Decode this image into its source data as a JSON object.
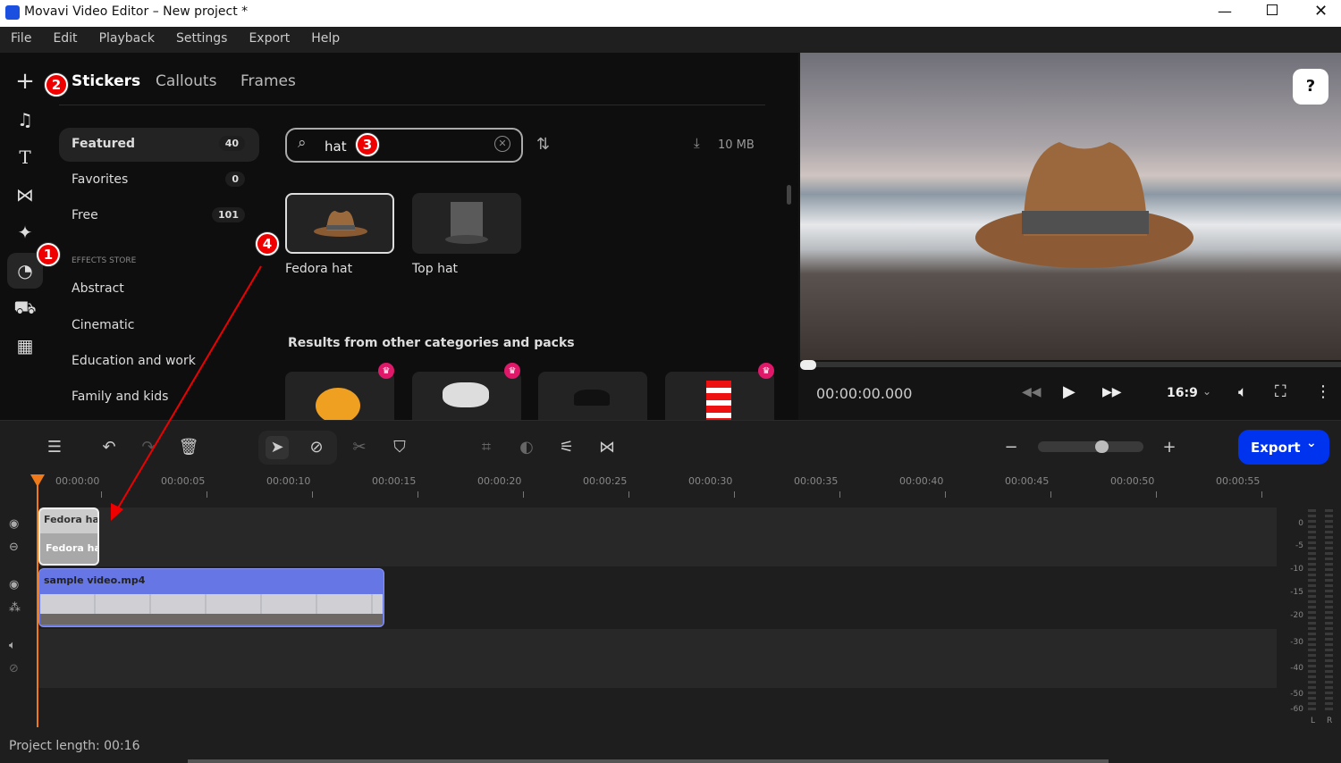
{
  "window": {
    "title": "Movavi Video Editor – New project *",
    "controls": [
      "minimize",
      "maximize",
      "close"
    ]
  },
  "menu": [
    "File",
    "Edit",
    "Playback",
    "Settings",
    "Export",
    "Help"
  ],
  "tabs": [
    {
      "label": "Stickers",
      "active": true
    },
    {
      "label": "Callouts"
    },
    {
      "label": "Frames"
    }
  ],
  "categories": [
    {
      "label": "Featured",
      "count": "40",
      "active": true
    },
    {
      "label": "Favorites",
      "count": "0"
    },
    {
      "label": "Free",
      "count": "101"
    }
  ],
  "effects_store": {
    "heading": "EFFECTS STORE",
    "items": [
      "Abstract",
      "Cinematic",
      "Education and work",
      "Family and kids"
    ]
  },
  "search": {
    "value": "hat",
    "download_size": "10 MB"
  },
  "results": [
    {
      "label": "Fedora hat",
      "selected": true
    },
    {
      "label": "Top hat"
    }
  ],
  "other_results_heading": "Results from other categories and packs",
  "annotations": [
    "1",
    "2",
    "3",
    "4"
  ],
  "player": {
    "timecode": "00:00:00.000",
    "aspect": "16:9",
    "progress": 0
  },
  "timeline": {
    "ticks": [
      "00:00:00",
      "00:00:05",
      "00:00:10",
      "00:00:15",
      "00:00:20",
      "00:00:25",
      "00:00:30",
      "00:00:35",
      "00:00:40",
      "00:00:45",
      "00:00:50",
      "00:00:55"
    ],
    "sticker_clip_top": "Fedora hat",
    "sticker_clip_bottom": "Fedora hat",
    "video_clip": "sample video.mp4",
    "zoom_level": 0.6
  },
  "export_label": "Export",
  "meter": {
    "scale": [
      "0",
      "-5",
      "-10",
      "-15",
      "-20",
      "-30",
      "-40",
      "-50",
      "-60"
    ],
    "channels": [
      "L",
      "R"
    ]
  },
  "status": "Project length: 00:16",
  "colors": {
    "accent": "#0033ee",
    "annotation": "#e00000",
    "playhead": "#f07a1a",
    "video_clip": "#6676e4"
  }
}
